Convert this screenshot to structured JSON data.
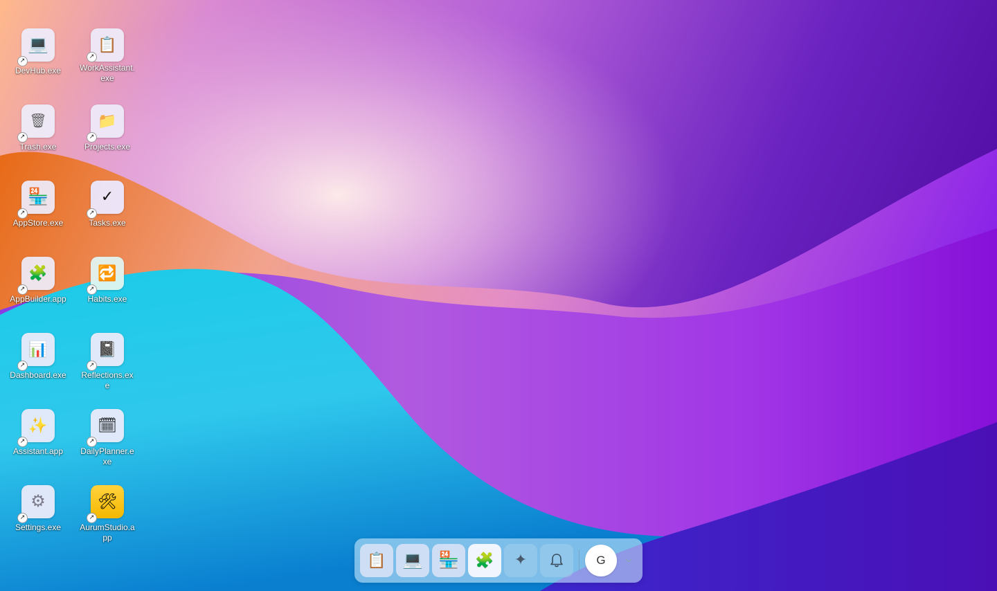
{
  "desktop": {
    "icons": [
      {
        "label": "DevHub.exe",
        "icon": "computer-icon",
        "glyph": "💻"
      },
      {
        "label": "WorkAssistant.exe",
        "icon": "clipboard-icon",
        "glyph": "📋"
      },
      {
        "label": "Trash.exe",
        "icon": "trash-icon",
        "glyph": "🗑"
      },
      {
        "label": "Projects.exe",
        "icon": "folder-icon",
        "glyph": "📁"
      },
      {
        "label": "AppStore.exe",
        "icon": "store-icon",
        "glyph": "🏪"
      },
      {
        "label": "Tasks.exe",
        "icon": "checkmark-icon",
        "glyph": "✓"
      },
      {
        "label": "AppBuilder.app",
        "icon": "puzzle-icon",
        "glyph": "🧩"
      },
      {
        "label": "Habits.exe",
        "icon": "repeat-icon",
        "glyph": "🔁"
      },
      {
        "label": "Dashboard.exe",
        "icon": "bar-chart-icon",
        "glyph": "📊"
      },
      {
        "label": "Reflections.exe",
        "icon": "notebook-icon",
        "glyph": "📓"
      },
      {
        "label": "Assistant.app",
        "icon": "sparkles-icon",
        "glyph": "✨"
      },
      {
        "label": "DailyPlanner.exe",
        "icon": "calendar-icon",
        "glyph": "🗓"
      },
      {
        "label": "Settings.exe",
        "icon": "gear-icon",
        "glyph": "⚙"
      },
      {
        "label": "AurumStudio.app",
        "icon": "hammer-wrench-icon",
        "glyph": "🛠"
      }
    ],
    "shortcut_glyph": "↗"
  },
  "taskbar": {
    "apps": [
      {
        "icon": "clipboard-icon",
        "glyph": "📋"
      },
      {
        "icon": "computer-icon",
        "glyph": "💻"
      },
      {
        "icon": "store-icon",
        "glyph": "🏪"
      },
      {
        "icon": "puzzle-icon",
        "glyph": "🧩"
      }
    ],
    "assistant": {
      "icon": "sparkle-icon",
      "glyph": "✦"
    },
    "notifications": {
      "icon": "bell-icon",
      "glyph": "🔔"
    },
    "user": {
      "initial": "G"
    },
    "menu": {
      "icon": "chevron-down-icon",
      "glyph": "⌄"
    }
  },
  "colors": {
    "wallpaper_orange": "#f08a3e",
    "wallpaper_violet": "#8a2be2",
    "wallpaper_cyan": "#21c8ea",
    "wallpaper_deep_purple": "#4b10b0"
  }
}
